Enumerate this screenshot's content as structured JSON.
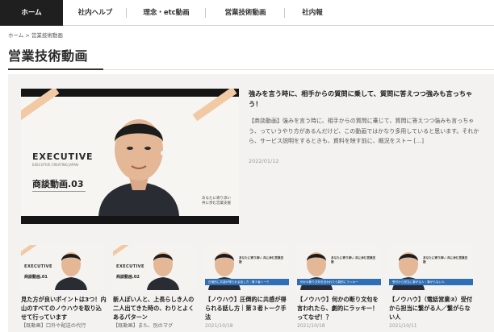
{
  "nav": {
    "items": [
      {
        "label": "ホーム",
        "active": true
      },
      {
        "label": "社内ヘルプ",
        "active": false
      },
      {
        "label": "理念・etc動画",
        "active": false
      },
      {
        "label": "営業技術動画",
        "active": false
      },
      {
        "label": "社内報",
        "active": false
      }
    ]
  },
  "breadcrumb": {
    "home": "ホーム",
    "separator": ">",
    "current": "営業技術動画"
  },
  "page": {
    "title": "営業技術動画"
  },
  "featured": {
    "title": "強みを言う時に、相手からの質問に乗して、質問に答えつつ強みも言っちゃう！",
    "excerpt": "【商談動画】強みを言う時に、相手からの質問に乗じて、質問に答えつつ強みも言っちゃう、っていうやり方があるんだけど、この動画ではかなり多用していると思います。それから、サービス説明をするときも、資料を映す前に、概況をストー [...]",
    "date": "2022/01/12",
    "thumb": {
      "brand": "EXECUTIVE",
      "brand_sub": "EXECUTIVE CREATING JAPAN",
      "label": "商談動画.03",
      "caption_1": "あなたに寄り添い",
      "caption_2": "共に歩む営業支援"
    }
  },
  "cards": [
    {
      "title": "見た方が良いポイントは3つ！内山のすべてのノウハウを取り込せて行っています",
      "excerpt": "【既動画】口外や配送の代行",
      "date": "",
      "thumb_type": "brand",
      "thumb": {
        "brand": "EXECUTIVE",
        "label": "商談動画.01",
        "text": "",
        "band": ""
      }
    },
    {
      "title": "新人ぽい人と、上長らしき人の二人出てきた時の、わりとよくあるパターン",
      "excerpt": "【既動画】また、別のマグ",
      "date": "",
      "thumb_type": "brand",
      "thumb": {
        "brand": "EXECUTIVE",
        "label": "商談動画.02",
        "text": "",
        "band": ""
      }
    },
    {
      "title": "【ノウハウ】圧倒的に共感が得られる話し方｜第３者トーク手法",
      "excerpt": "",
      "date": "2021/10/18",
      "thumb_type": "talk",
      "thumb": {
        "brand": "",
        "label": "",
        "text": "あなたに寄り添い 共に歩む営業支援",
        "band": "圧倒的に共感が得られる話し方｜第３者トーク"
      }
    },
    {
      "title": "【ノウハウ】何かの断り文句を言われたら、劇的にラッキー！ってなぜ！？",
      "excerpt": "",
      "date": "2021/10/18",
      "thumb_type": "talk",
      "thumb": {
        "brand": "",
        "label": "",
        "text": "あなたに寄り添い 共に歩む営業支援",
        "band": "何かの断り文句を言われたら劇的にラッキー"
      }
    },
    {
      "title": "【ノウハウ】（電話営業③）受付から担当に繋がる人／繋がらない人",
      "excerpt": "",
      "date": "2021/10/11",
      "thumb_type": "talk",
      "thumb": {
        "brand": "",
        "label": "",
        "text": "あなたに寄り添い 共に歩む営業支援",
        "band": "受付から担当に繋がる人・繋がらない人"
      }
    }
  ],
  "colors": {
    "accent": "#1f1f1f",
    "band": "#2e6fb8",
    "stripe": "#f2c9a5",
    "content_bg": "#f3f2f0"
  }
}
